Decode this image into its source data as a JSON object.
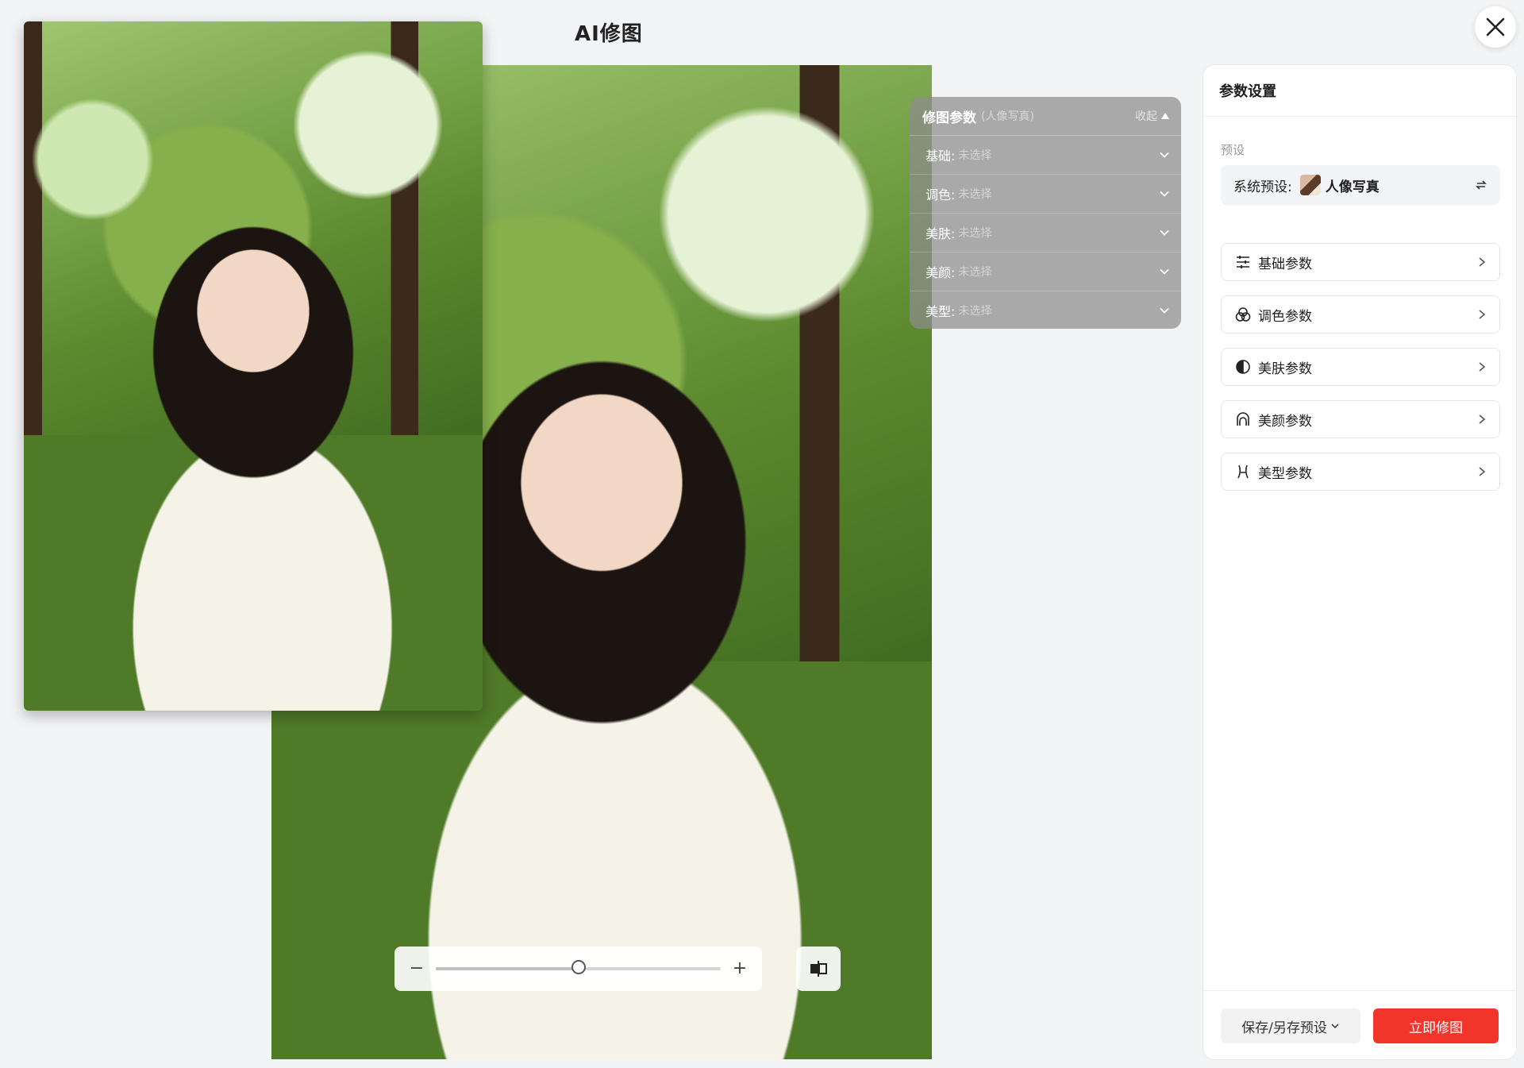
{
  "header": {
    "title": "AI修图"
  },
  "overlay": {
    "title": "修图参数",
    "subtitle": "(人像写真)",
    "collapse_label": "收起",
    "rows": [
      {
        "label": "基础:",
        "value": "未选择"
      },
      {
        "label": "调色:",
        "value": "未选择"
      },
      {
        "label": "美肤:",
        "value": "未选择"
      },
      {
        "label": "美颜:",
        "value": "未选择"
      },
      {
        "label": "美型:",
        "value": "未选择"
      }
    ]
  },
  "zoom": {
    "minus": "−",
    "plus": "+",
    "level": 0.5
  },
  "panel": {
    "title": "参数设置",
    "preset_section_label": "预设",
    "system_preset_label": "系统预设:",
    "system_preset_value": "人像写真",
    "categories": [
      {
        "label": "基础参数",
        "icon": "sliders-icon"
      },
      {
        "label": "调色参数",
        "icon": "color-circles-icon"
      },
      {
        "label": "美肤参数",
        "icon": "skin-icon"
      },
      {
        "label": "美颜参数",
        "icon": "face-icon"
      },
      {
        "label": "美型参数",
        "icon": "body-shape-icon"
      }
    ],
    "save_label": "保存/另存预设",
    "apply_label": "立即修图"
  },
  "colors": {
    "accent": "#f2352b",
    "overlay": "#8c8c8c"
  }
}
